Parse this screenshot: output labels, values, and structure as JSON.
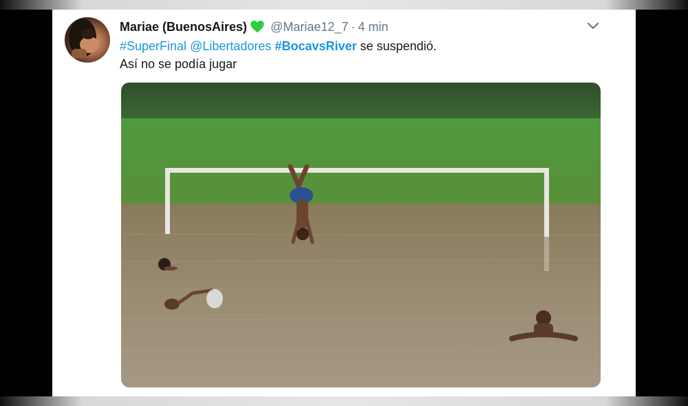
{
  "tweet": {
    "display_name": "Mariae (BuenosAires)",
    "handle": "@Mariae12_7",
    "separator": "·",
    "time": "4 min",
    "line1": {
      "hashtag1": "#SuperFinal",
      "mention": "@Libertadores",
      "hashtag2": "#BocavsRiver",
      "rest": "se suspendió."
    },
    "line2": "Así no se podía jugar"
  },
  "icons": {
    "heart": "green-heart-icon",
    "menu": "chevron-down-icon"
  },
  "colors": {
    "link": "#1b95e0",
    "name": "#14171a",
    "meta": "#657786",
    "heart": "#2ecc40"
  }
}
